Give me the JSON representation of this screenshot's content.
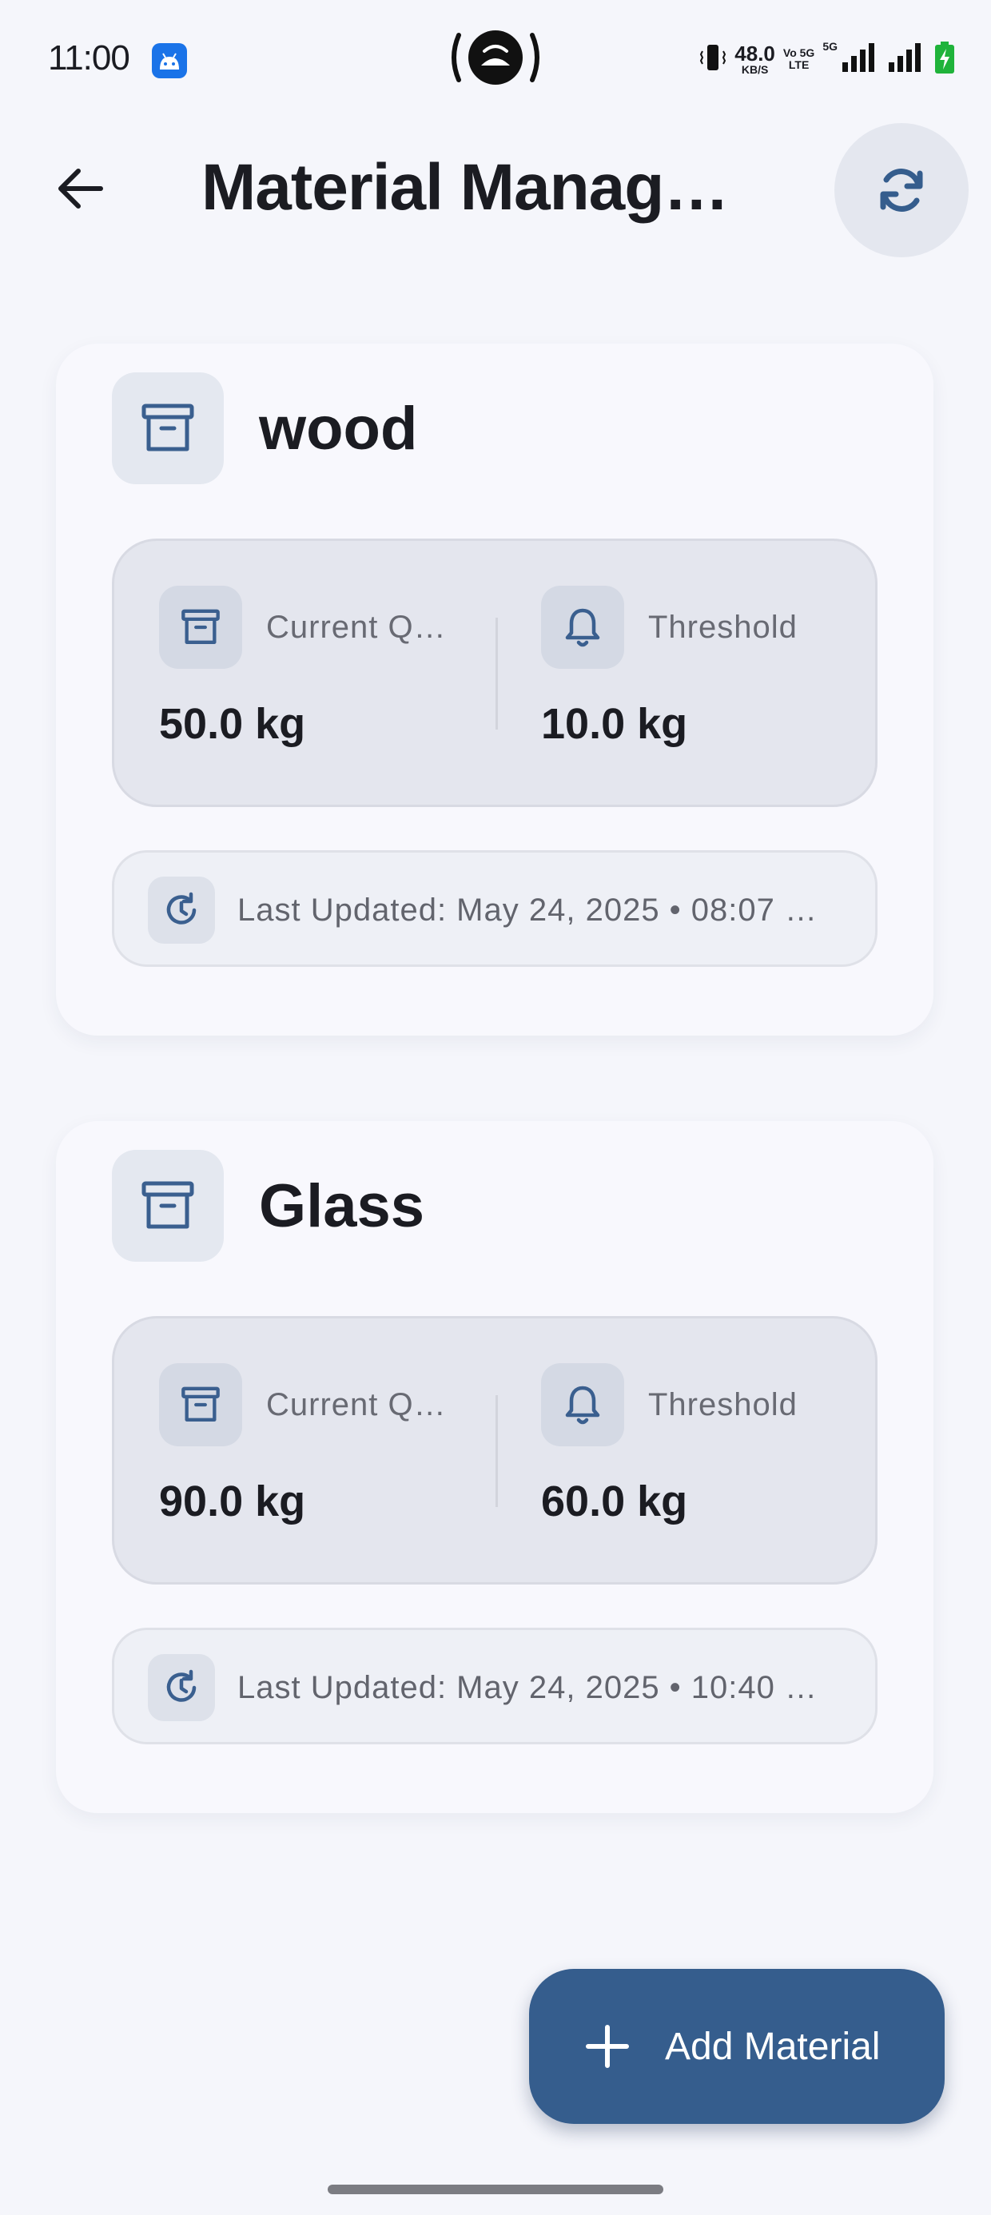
{
  "status_bar": {
    "time": "11:00",
    "net_speed_value": "48.0",
    "net_speed_unit": "KB/S",
    "volte_top": "Vo 5G",
    "volte_bottom": "LTE",
    "five_g": "5G",
    "icons": [
      "android-app-icon",
      "hotspot-icon",
      "vibrate-icon",
      "signal-icon",
      "signal-icon",
      "battery-charging-icon"
    ]
  },
  "app_bar": {
    "title": "Material Management",
    "back_icon": "arrow-left-icon",
    "refresh_icon": "refresh-icon"
  },
  "materials": [
    {
      "name": "wood",
      "quantity_label": "Current Quantity",
      "quantity_value": "50.0 kg",
      "threshold_label": "Threshold",
      "threshold_value": "10.0 kg",
      "last_updated": "Last Updated: May 24, 2025 • 08:07 …"
    },
    {
      "name": "Glass",
      "quantity_label": "Current Quantity",
      "quantity_value": "90.0 kg",
      "threshold_label": "Threshold",
      "threshold_value": "60.0 kg",
      "last_updated": "Last Updated: May 24, 2025 • 10:40 …"
    }
  ],
  "fab": {
    "label": "Add Material",
    "icon": "plus-icon"
  },
  "colors": {
    "accent": "#355d8d",
    "background": "#f5f6fb",
    "card": "#f8f8fd",
    "stats_box": "#e4e6ee",
    "icon_tint": "#3a5f8f"
  }
}
